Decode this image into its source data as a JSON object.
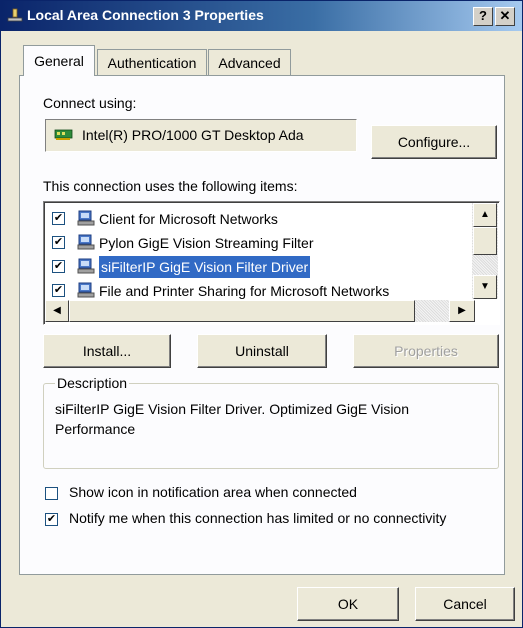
{
  "window": {
    "title": "Local Area Connection 3 Properties",
    "help_label": "?",
    "close_label": "✕"
  },
  "tabs": [
    {
      "label": "General",
      "active": true
    },
    {
      "label": "Authentication",
      "active": false
    },
    {
      "label": "Advanced",
      "active": false
    }
  ],
  "connect_using": {
    "label": "Connect using:",
    "adapter": "Intel(R) PRO/1000 GT Desktop Ada",
    "configure_label": "Configure..."
  },
  "items": {
    "label": "This connection uses the following items:",
    "rows": [
      {
        "label": "Client for Microsoft Networks",
        "checked": true,
        "selected": false
      },
      {
        "label": "Pylon GigE Vision Streaming Filter",
        "checked": true,
        "selected": false
      },
      {
        "label": "siFilterIP GigE Vision Filter Driver",
        "checked": true,
        "selected": true
      },
      {
        "label": "File and Printer Sharing for Microsoft Networks",
        "checked": true,
        "selected": false
      }
    ]
  },
  "buttons": {
    "install": "Install...",
    "uninstall": "Uninstall",
    "properties": "Properties",
    "ok": "OK",
    "cancel": "Cancel"
  },
  "description": {
    "legend": "Description",
    "text_line1": "siFilterIP GigE Vision Filter Driver. Optimized GigE Vision",
    "text_line2": "Performance"
  },
  "options": {
    "show_icon": {
      "label": "Show icon in notification area when connected",
      "checked": false
    },
    "notify": {
      "label": "Notify me when this connection has limited or no connectivity",
      "checked": true
    }
  },
  "colors": {
    "title_bar": "#0a246a",
    "selection": "#316ac5",
    "dialog_bg": "#ece9d8"
  }
}
